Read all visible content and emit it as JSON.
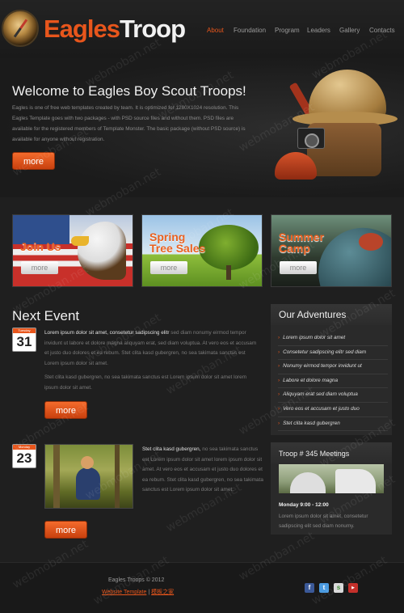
{
  "header": {
    "logo_part1": "Eagles",
    "logo_part2": "Troop",
    "nav": [
      "About",
      "Foundation",
      "Program",
      "Leaders",
      "Gallery",
      "Contacts"
    ]
  },
  "hero": {
    "title": "Welcome to Eagles Boy Scout Troops!",
    "text": "Eagles is one of free web templates created by team. It is optimized for 1280X1024 resolution. This Eagles Template goes with two packages - with PSD source files and without them. PSD files are available for the registered members of Template Monster. The basic package (without PSD source) is available for anyone without registration.",
    "button": "more"
  },
  "banners": [
    {
      "title_line1": "Join Us",
      "title_line2": "",
      "button": "more"
    },
    {
      "title_line1": "Spring",
      "title_line2": "Tree Sales",
      "button": "more"
    },
    {
      "title_line1": "Summer",
      "title_line2": "Camp",
      "button": "more"
    }
  ],
  "next_event": {
    "title": "Next Event",
    "event1": {
      "month": "Tuesday",
      "day": "31",
      "lead": "Lorem ipsum dolor sit amet, consetetur sadipscing elitr",
      "text": " sed diam nonumy eirmod tempor invidunt ut labore et dolore magna aliquyam erat, sed diam voluptua. At vero eos et accusam et justo duo dolores et ea rebum. Stet clita kasd gubergren, no sea takimata sanctus est Lorem ipsum dolor sit amet.",
      "text2": "Stet clita kasd gubergren, no sea takimata sanctus est Lorem ipsum dolor sit amet lorem ipsum dolor sit amet.",
      "button": "more"
    },
    "event2": {
      "month": "Monday",
      "day": "23",
      "lead": "Stet clita kasd gubergren,",
      "text": " no sea takimata sanctus est Lorem ipsum dolor sit amet lorem ipsum dolor sit amet. At vero eos et accusam et justo duo dolores et ea rebum. Stet clita kasd gubergren, no sea takimata sanctus est Lorem ipsum dolor sit amet.",
      "button": "more"
    }
  },
  "adventures": {
    "title": "Our Adventures",
    "items": [
      "Lorem ipsum dolor sit amet",
      "Consetetur sadipscing elitr sed diam",
      "Nonumy eirmod tempor invidunt ut",
      "Labore et dolore magna",
      "Aliquyam erat sed diam voluptua",
      "Vero eos et accusam et justo duo",
      "Stet clita kasd gubergren"
    ]
  },
  "meetings": {
    "title": "Troop # 345 Meetings",
    "when": "Monday 9:00 - 12:00",
    "text": "Lorem ipsum dolor sit amet, consetetur sadipscing elit sed diam nonumy."
  },
  "footer": {
    "copyright": "Eagles Troops © 2012",
    "link1": "Website Template",
    "separator": "|",
    "link2": "模板之家"
  },
  "watermark": "webmoban.net"
}
